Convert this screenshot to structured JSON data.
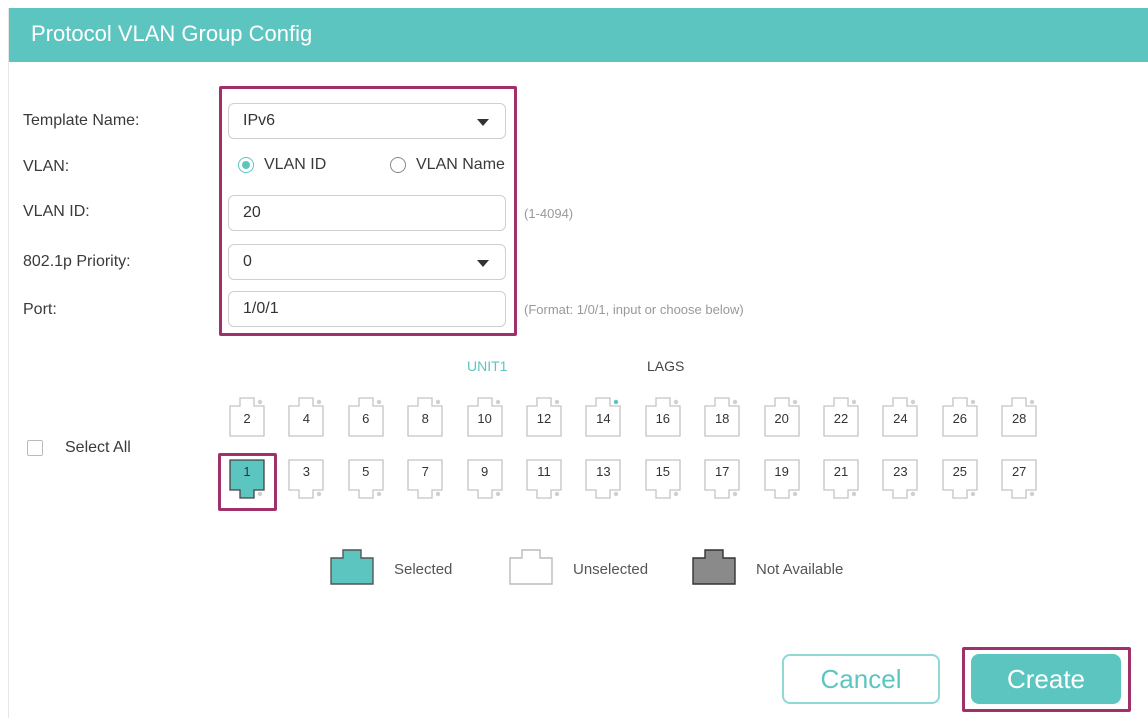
{
  "dialog": {
    "title": "Protocol VLAN Group Config"
  },
  "form": {
    "template_name": {
      "label": "Template Name:",
      "value": "IPv6"
    },
    "vlan": {
      "label": "VLAN:",
      "options": [
        {
          "label": "VLAN ID",
          "selected": true
        },
        {
          "label": "VLAN Name",
          "selected": false
        }
      ]
    },
    "vlan_id": {
      "label": "VLAN ID:",
      "value": "20",
      "hint": "(1-4094)"
    },
    "priority": {
      "label": "802.1p Priority:",
      "value": "0"
    },
    "port": {
      "label": "Port:",
      "value": "1/0/1",
      "hint": "(Format: 1/0/1, input or choose below)"
    }
  },
  "port_panel": {
    "select_all_label": "Select All",
    "tabs": [
      {
        "label": "UNIT1",
        "active": true
      },
      {
        "label": "LAGS",
        "active": false
      }
    ],
    "top_row": [
      "2",
      "4",
      "6",
      "8",
      "10",
      "12",
      "14",
      "16",
      "18",
      "20",
      "22",
      "24",
      "26",
      "28"
    ],
    "bottom_row": [
      "1",
      "3",
      "5",
      "7",
      "9",
      "11",
      "13",
      "15",
      "17",
      "19",
      "21",
      "23",
      "25",
      "27"
    ],
    "selected_ports": [
      "1"
    ],
    "link_up_ports": [
      "14"
    ]
  },
  "legend": {
    "selected": "Selected",
    "unselected": "Unselected",
    "not_available": "Not Available"
  },
  "buttons": {
    "cancel": "Cancel",
    "create": "Create"
  },
  "colors": {
    "accent": "#5dc5c0",
    "highlight": "#a0306a",
    "not_available": "#8a8a8a"
  }
}
